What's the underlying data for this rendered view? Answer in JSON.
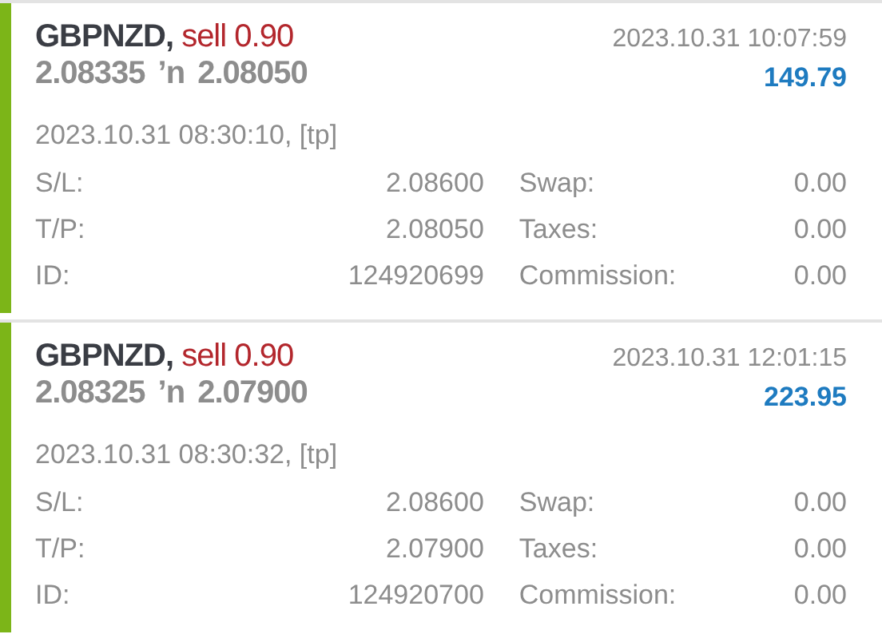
{
  "trades": [
    {
      "symbol": "GBPNZD,",
      "side": "sell",
      "volume": "0.90",
      "open_price": "2.08335",
      "arrow": "ʼn",
      "close_price": "2.08050",
      "close_time": "2023.10.31 10:07:59",
      "profit": "149.79",
      "open_time": "2023.10.31 08:30:10, [tp]",
      "details": [
        [
          "S/L:",
          "2.08600",
          "Swap:",
          "0.00"
        ],
        [
          "T/P:",
          "2.08050",
          "Taxes:",
          "0.00"
        ],
        [
          "ID:",
          "124920699",
          "Commission:",
          "0.00"
        ]
      ]
    },
    {
      "symbol": "GBPNZD,",
      "side": "sell",
      "volume": "0.90",
      "open_price": "2.08325",
      "arrow": "ʼn",
      "close_price": "2.07900",
      "close_time": "2023.10.31 12:01:15",
      "profit": "223.95",
      "open_time": "2023.10.31 08:30:32, [tp]",
      "details": [
        [
          "S/L:",
          "2.08600",
          "Swap:",
          "0.00"
        ],
        [
          "T/P:",
          "2.07900",
          "Taxes:",
          "0.00"
        ],
        [
          "ID:",
          "124920700",
          "Commission:",
          "0.00"
        ]
      ]
    }
  ]
}
